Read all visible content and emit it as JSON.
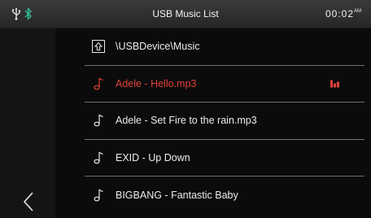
{
  "header": {
    "title": "USB Music List",
    "time": "00:02",
    "ampm": "AM"
  },
  "path": {
    "label": "\\USBDevice\\Music"
  },
  "tracks": [
    {
      "label": "Adele - Hello.mp3",
      "playing": true
    },
    {
      "label": "Adele - Set Fire to the rain.mp3",
      "playing": false
    },
    {
      "label": "EXID -  Up Down",
      "playing": false
    },
    {
      "label": "BIGBANG - Fantastic Baby",
      "playing": false
    }
  ],
  "colors": {
    "accent": "#e0433a",
    "text": "#ececec",
    "bluetooth": "#2fbf9a"
  },
  "icons": [
    "usb-icon",
    "bluetooth-icon",
    "folder-up-icon",
    "music-note-icon",
    "equalizer-icon",
    "back-chevron-icon"
  ]
}
